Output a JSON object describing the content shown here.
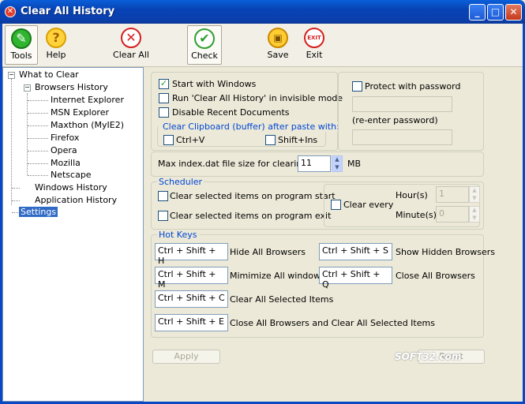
{
  "window": {
    "title": "Clear All History",
    "min": "_",
    "max": "□",
    "close": "✕"
  },
  "toolbar": {
    "tools": "Tools",
    "help": "Help",
    "clear_all": "Clear All",
    "check": "Check",
    "save": "Save",
    "exit": "Exit",
    "exit_icon_text": "EXIT"
  },
  "tree": {
    "root": "What to Clear",
    "browsers": "Browsers History",
    "browser_items": [
      "Internet Explorer",
      "MSN Explorer",
      "Maxthon (MyIE2)",
      "Firefox",
      "Opera",
      "Mozilla",
      "Netscape"
    ],
    "windows": "Windows History",
    "application": "Application History",
    "settings": "Settings"
  },
  "general": {
    "start_with_windows": "Start with Windows",
    "start_with_windows_checked": true,
    "invisible_mode": "Run 'Clear All History' in invisible mode",
    "disable_recent": "Disable Recent Documents",
    "clipboard_legend": "Clear Clipboard (buffer) after paste with:",
    "ctrl_v": "Ctrl+V",
    "shift_ins": "Shift+Ins"
  },
  "password": {
    "protect": "Protect with password",
    "reenter": "(re-enter password)"
  },
  "index": {
    "label": "Max index.dat file size for clearing",
    "value": "11",
    "unit": "MB"
  },
  "scheduler": {
    "legend": "Scheduler",
    "on_start": "Clear selected items on program start",
    "on_exit": "Clear selected items on program exit",
    "clear_every": "Clear every",
    "hours_label": "Hour(s)",
    "hours_value": "1",
    "minutes_label": "Minute(s)",
    "minutes_value": "0"
  },
  "hotkeys": {
    "legend": "Hot Keys",
    "items": [
      {
        "keys": "Ctrl + Shift + H",
        "action": "Hide All Browsers"
      },
      {
        "keys": "Ctrl + Shift + S",
        "action": "Show Hidden Browsers"
      },
      {
        "keys": "Ctrl + Shift + M",
        "action": "Mimimize All windows"
      },
      {
        "keys": "Ctrl + Shift + Q",
        "action": "Close All Browsers"
      },
      {
        "keys": "Ctrl + Shift + C",
        "action": "Clear All Selected Items"
      },
      {
        "keys": "Ctrl + Shift + E",
        "action": "Close All Browsers and Clear All Selected Items"
      }
    ]
  },
  "buttons": {
    "apply": "Apply",
    "reset": "Reset"
  },
  "watermark": "SOFT32.com",
  "colors": {
    "titlebar": "#0a47c2",
    "legend_blue": "#0046d5",
    "selection": "#316ac5"
  }
}
